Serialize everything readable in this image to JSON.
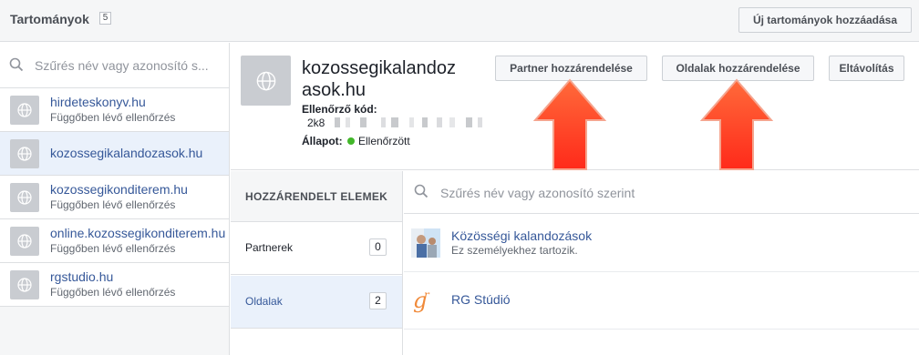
{
  "header": {
    "title": "Tartományok",
    "count": "5",
    "add_button": "Új tartományok hozzáadása"
  },
  "sidebar": {
    "search_placeholder": "Szűrés név vagy azonosító s...",
    "items": [
      {
        "name": "hirdeteskonyv.hu",
        "status": "Függőben lévő ellenőrzés"
      },
      {
        "name": "kozossegikalandozasok.hu",
        "status": ""
      },
      {
        "name": "kozossegikonditerem.hu",
        "status": "Függőben lévő ellenőrzés"
      },
      {
        "name": "online.kozossegikonditerem.hu",
        "status": "Függőben lévő ellenőrzés"
      },
      {
        "name": "rgstudio.hu",
        "status": "Függőben lévő ellenőrzés"
      }
    ]
  },
  "detail": {
    "domain_name": "kozossegikalandozasok.hu",
    "verify_label": "Ellenőrző kód:",
    "verify_code_visible": "2k8",
    "status_label": "Állapot:",
    "status_value": "Ellenőrzött",
    "status_color": "#42b72a",
    "buttons": {
      "partner": "Partner hozzárendelése",
      "pages": "Oldalak hozzárendelése",
      "remove": "Eltávolítás"
    }
  },
  "assigned": {
    "header": "HOZZÁRENDELT ELEMEK",
    "categories": [
      {
        "label": "Partnerek",
        "count": "0"
      },
      {
        "label": "Oldalak",
        "count": "2"
      }
    ]
  },
  "assets": {
    "search_placeholder": "Szűrés név vagy azonosító szerint",
    "items": [
      {
        "name": "Közösségi kalandozások",
        "sub": "Ez személyekhez tartozik."
      },
      {
        "name": "RG Stúdió",
        "sub": ""
      }
    ]
  },
  "colors": {
    "link": "#365899",
    "arrow": "#ff4a2a",
    "selected_bg": "#eaf1fb"
  }
}
